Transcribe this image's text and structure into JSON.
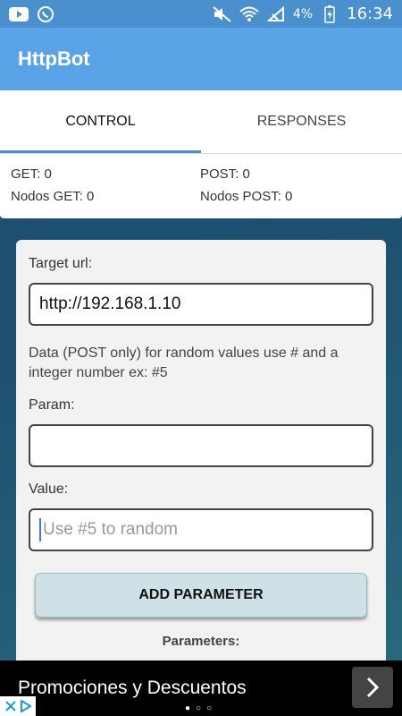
{
  "status_bar": {
    "battery": "4%",
    "time": "16:34",
    "icons": [
      "youtube-icon",
      "whatsapp-icon",
      "mute-icon",
      "wifi-icon",
      "no-signal-icon",
      "battery-icon"
    ]
  },
  "app_bar": {
    "title": "HttpBot"
  },
  "tabs": [
    {
      "label": "CONTROL",
      "active": true
    },
    {
      "label": "RESPONSES",
      "active": false
    }
  ],
  "counts": {
    "get": "GET: 0",
    "post": "POST: 0",
    "nodos_get": "Nodos GET: 0",
    "nodos_post": "Nodos POST: 0"
  },
  "form": {
    "target_label": "Target url:",
    "target_value": "http://192.168.1.10",
    "hint": "Data (POST only) for random values use # and a integer number ex: #5",
    "param_label": "Param:",
    "param_value": "",
    "value_label": "Value:",
    "value_placeholder": "Use #5 to random",
    "add_button": "ADD PARAMETER",
    "parameters_title": "Parameters:"
  },
  "ad": {
    "text": "Promociones y Descuentos",
    "dots": "●○○"
  },
  "colors": {
    "status_bar": "#4a90cf",
    "app_bar": "#5aa3e6",
    "accent": "#4a90cf"
  }
}
